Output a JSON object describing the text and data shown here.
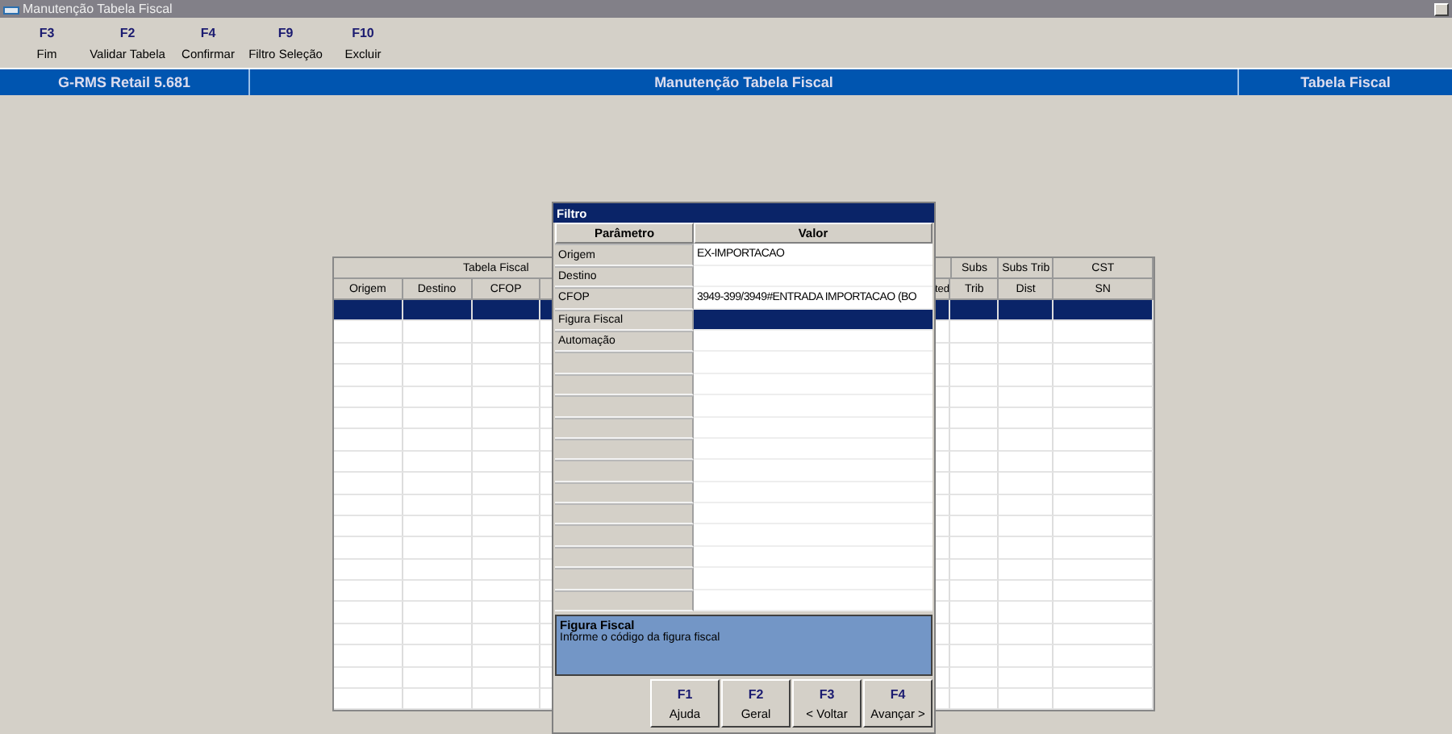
{
  "window": {
    "title": "Manutenção Tabela Fiscal"
  },
  "toolbar": [
    {
      "key": "F3",
      "label": "Fim"
    },
    {
      "key": "F2",
      "label": "Validar Tabela"
    },
    {
      "key": "F4",
      "label": "Confirmar"
    },
    {
      "key": "F9",
      "label": "Filtro Seleção"
    },
    {
      "key": "F10",
      "label": "Excluir"
    }
  ],
  "header_bar": {
    "product": "G-RMS Retail 5.681",
    "screen": "Manutenção Tabela Fiscal",
    "section": "Tabela Fiscal"
  },
  "table": {
    "group_heading": "Tabela Fiscal",
    "columns": [
      {
        "bottom": "Origem"
      },
      {
        "bottom": "Destino"
      },
      {
        "bottom": "CFOP"
      },
      {
        "bottom": "ted"
      },
      {
        "top": "Subs",
        "bottom": "Trib"
      },
      {
        "top": "Subs Trib",
        "bottom": "Dist"
      },
      {
        "top": "CST",
        "bottom": "SN"
      }
    ],
    "rows": [
      {
        "selected": true
      },
      {
        "selected": false
      },
      {
        "selected": false
      },
      {
        "selected": false
      },
      {
        "selected": false
      },
      {
        "selected": false
      },
      {
        "selected": false
      },
      {
        "selected": false
      },
      {
        "selected": false
      },
      {
        "selected": false
      },
      {
        "selected": false
      },
      {
        "selected": false
      },
      {
        "selected": false
      },
      {
        "selected": false
      },
      {
        "selected": false
      },
      {
        "selected": false
      },
      {
        "selected": false
      },
      {
        "selected": false
      },
      {
        "selected": false
      }
    ]
  },
  "dialog": {
    "title": "Filtro",
    "columns": [
      "Parâmetro",
      "Valor"
    ],
    "params": [
      {
        "name": "Origem",
        "value": "EX-IMPORTACAO",
        "selected": false
      },
      {
        "name": "Destino",
        "selected": false
      },
      {
        "name": "CFOP",
        "value": "3949-399/3949#ENTRADA IMPORTACAO (BO",
        "selected": false
      },
      {
        "name": "Figura Fiscal",
        "selected": true
      },
      {
        "name": "Automação",
        "selected": false
      }
    ],
    "help": {
      "title": "Figura Fiscal",
      "text": "Informe o código da figura fiscal"
    },
    "buttons": [
      {
        "key": "F1",
        "label": "Ajuda"
      },
      {
        "key": "F2",
        "label": "Geral"
      },
      {
        "key": "F3",
        "label": "< Voltar"
      },
      {
        "key": "F4",
        "label": "Avançar >"
      }
    ]
  }
}
